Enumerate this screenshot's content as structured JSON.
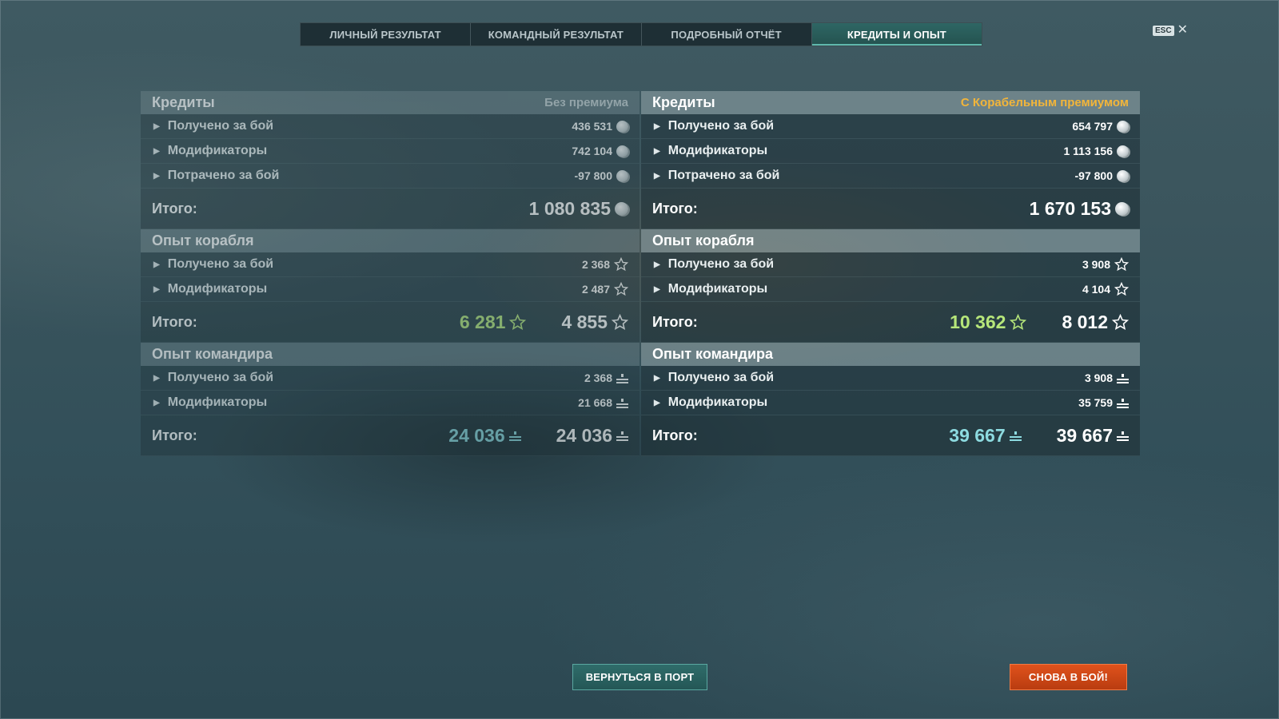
{
  "tabs": [
    {
      "label": "ЛИЧНЫЙ РЕЗУЛЬТАТ",
      "active": false
    },
    {
      "label": "КОМАНДНЫЙ РЕЗУЛЬТАТ",
      "active": false
    },
    {
      "label": "ПОДРОБНЫЙ ОТЧЁТ",
      "active": false
    },
    {
      "label": "КРЕДИТЫ И ОПЫТ",
      "active": true
    }
  ],
  "esc": {
    "key": "ESC",
    "close_glyph": "✕"
  },
  "left": {
    "credits": {
      "title": "Кредиты",
      "subtitle": "Без премиума",
      "rows": [
        {
          "label": "Получено за бой",
          "value": "436 531",
          "icon": "credits-icon"
        },
        {
          "label": "Модификаторы",
          "value": "742 104",
          "icon": "credits-icon"
        },
        {
          "label": "Потрачено за бой",
          "value": "-97 800",
          "icon": "credits-icon"
        }
      ],
      "total_label": "Итого:",
      "total": "1 080 835"
    },
    "ship_xp": {
      "title": "Опыт корабля",
      "rows": [
        {
          "label": "Получено за бой",
          "value": "2 368",
          "icon": "star-icon"
        },
        {
          "label": "Модификаторы",
          "value": "2 487",
          "icon": "star-icon"
        }
      ],
      "total_label": "Итого:",
      "total_free": "6 281",
      "total": "4 855"
    },
    "commander_xp": {
      "title": "Опыт командира",
      "rows": [
        {
          "label": "Получено за бой",
          "value": "2 368",
          "icon": "commander-xp-icon"
        },
        {
          "label": "Модификаторы",
          "value": "21 668",
          "icon": "commander-xp-icon"
        }
      ],
      "total_label": "Итого:",
      "total_elite": "24 036",
      "total": "24 036"
    }
  },
  "right": {
    "credits": {
      "title": "Кредиты",
      "subtitle": "С Корабельным премиумом",
      "rows": [
        {
          "label": "Получено за бой",
          "value": "654 797",
          "icon": "credits-icon"
        },
        {
          "label": "Модификаторы",
          "value": "1 113 156",
          "icon": "credits-icon"
        },
        {
          "label": "Потрачено за бой",
          "value": "-97 800",
          "icon": "credits-icon"
        }
      ],
      "total_label": "Итого:",
      "total": "1 670 153"
    },
    "ship_xp": {
      "title": "Опыт корабля",
      "rows": [
        {
          "label": "Получено за бой",
          "value": "3 908",
          "icon": "star-icon"
        },
        {
          "label": "Модификаторы",
          "value": "4 104",
          "icon": "star-icon"
        }
      ],
      "total_label": "Итого:",
      "total_free": "10 362",
      "total": "8 012"
    },
    "commander_xp": {
      "title": "Опыт командира",
      "rows": [
        {
          "label": "Получено за бой",
          "value": "3 908",
          "icon": "commander-xp-icon"
        },
        {
          "label": "Модификаторы",
          "value": "35 759",
          "icon": "commander-xp-icon"
        }
      ],
      "total_label": "Итого:",
      "total_elite": "39 667",
      "total": "39 667"
    }
  },
  "buttons": {
    "return_port": "ВЕРНУТЬСЯ В ПОРТ",
    "battle_again": "СНОВА В БОЙ!"
  },
  "colors": {
    "premium_accent": "#f2b53a",
    "free_xp_green": "#b6e67a",
    "elite_xp_cyan": "#8ddbe0",
    "active_tab": "#2e6664",
    "battle_button": "#d34a16"
  }
}
